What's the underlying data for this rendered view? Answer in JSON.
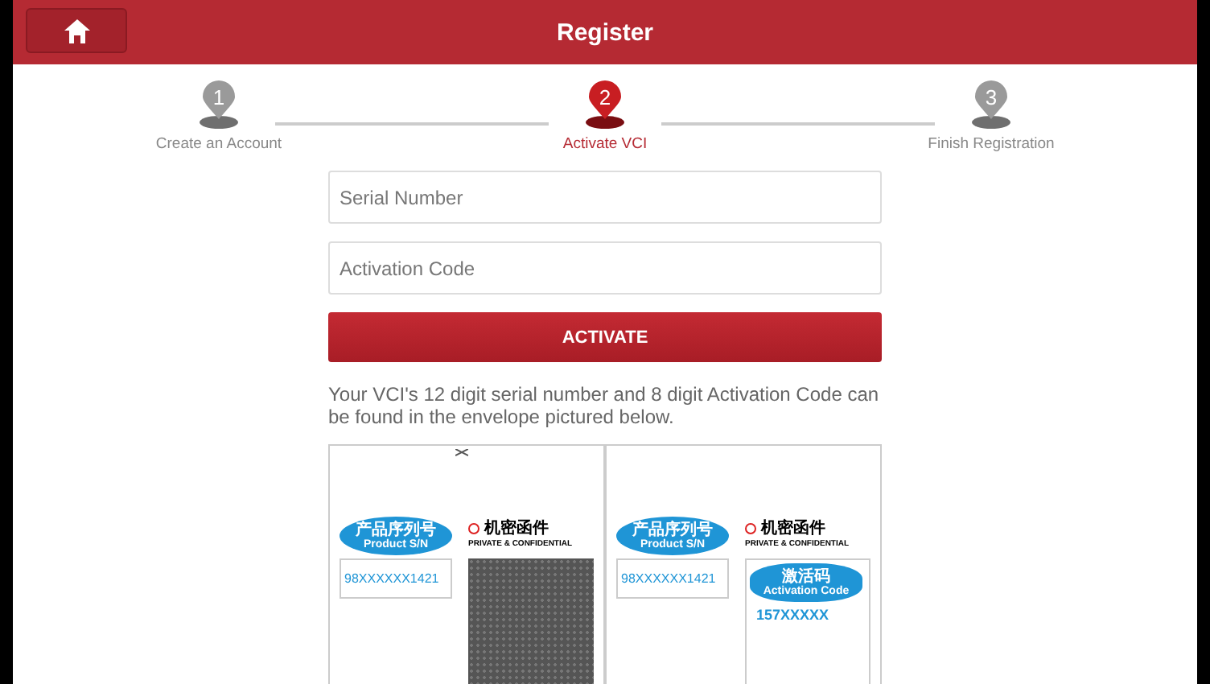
{
  "header": {
    "title": "Register"
  },
  "steps": [
    {
      "number": "1",
      "label": "Create an Account",
      "selected": false
    },
    {
      "number": "2",
      "label": "Activate VCI",
      "selected": true
    },
    {
      "number": "3",
      "label": "Finish Registration",
      "selected": false
    }
  ],
  "fields": [
    {
      "placeholder": "Serial Number"
    },
    {
      "placeholder": "Activation Code"
    }
  ],
  "activate_button": "ACTIVATE",
  "instructions": "Your VCI's 12 digit serial number and 8 digit Activation Code can be found in the envelope pictured below.",
  "envelope_images": [
    {
      "kind": "serial",
      "bubble_cn": "产品序列号",
      "bubble_en": "Product S/N",
      "serial": "98XXXXXX1421",
      "confidential_cn": "机密函件",
      "confidential_en": "PRIVATE & CONFIDENTIAL"
    },
    {
      "kind": "both",
      "bubble_cn": "产品序列号",
      "bubble_en": "Product S/N",
      "serial": "98XXXXXX1421",
      "confidential_cn": "机密函件",
      "confidential_en": "PRIVATE & CONFIDENTIAL",
      "code_cn": "激活码",
      "code_en": "Activation Code",
      "code": "157XXXXX"
    }
  ]
}
